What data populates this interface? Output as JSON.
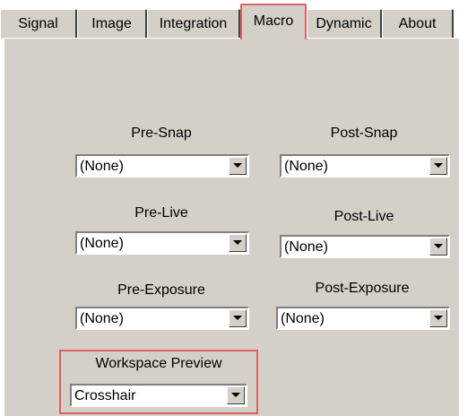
{
  "tabs": [
    "Signal",
    "Image",
    "Integration",
    "Macro",
    "Dynamic",
    "About"
  ],
  "selected_tab": "Macro",
  "macro": {
    "pre_snap": {
      "label": "Pre-Snap",
      "value": "(None)"
    },
    "post_snap": {
      "label": "Post-Snap",
      "value": "(None)"
    },
    "pre_live": {
      "label": "Pre-Live",
      "value": "(None)"
    },
    "post_live": {
      "label": "Post-Live",
      "value": "(None)"
    },
    "pre_exposure": {
      "label": "Pre-Exposure",
      "value": "(None)"
    },
    "post_exposure": {
      "label": "Post-Exposure",
      "value": "(None)"
    },
    "workspace_preview": {
      "label": "Workspace Preview",
      "value": "Crosshair"
    }
  },
  "colors": {
    "panel": "#d4d0c8",
    "highlight": "#e06060"
  }
}
